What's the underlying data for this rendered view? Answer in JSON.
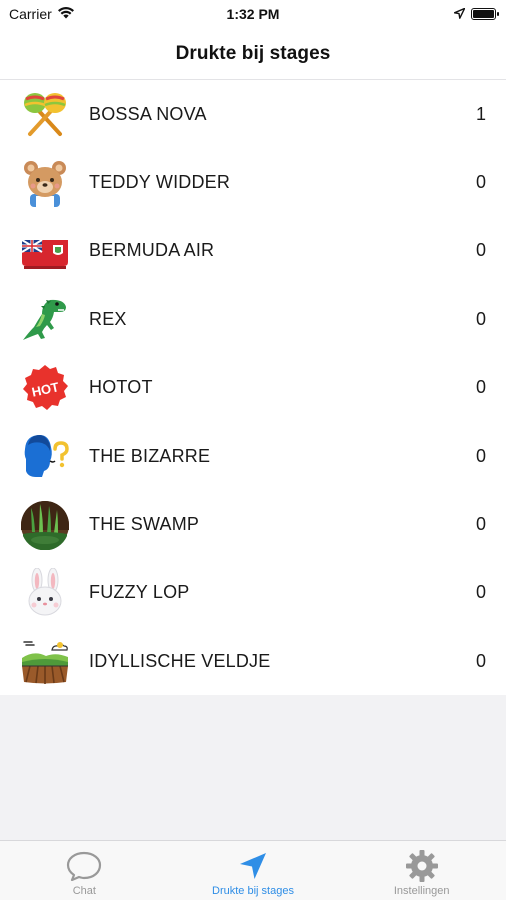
{
  "status_bar": {
    "carrier": "Carrier",
    "time": "1:32 PM"
  },
  "nav": {
    "title": "Drukte bij stages"
  },
  "stages": [
    {
      "name": "BOSSA NOVA",
      "count": "1",
      "icon": "maracas-icon"
    },
    {
      "name": "TEDDY WIDDER",
      "count": "0",
      "icon": "teddy-bear-icon"
    },
    {
      "name": "BERMUDA AIR",
      "count": "0",
      "icon": "bermuda-flag-plane-icon"
    },
    {
      "name": "REX",
      "count": "0",
      "icon": "dinosaur-icon"
    },
    {
      "name": "HOTOT",
      "count": "0",
      "icon": "hot-badge-icon"
    },
    {
      "name": "THE BIZARRE",
      "count": "0",
      "icon": "question-head-icon"
    },
    {
      "name": "THE SWAMP",
      "count": "0",
      "icon": "swamp-icon"
    },
    {
      "name": "FUZZY LOP",
      "count": "0",
      "icon": "rabbit-icon"
    },
    {
      "name": "IDYLLISCHE VELDJE",
      "count": "0",
      "icon": "field-landscape-icon"
    }
  ],
  "tabs": [
    {
      "label": "Chat",
      "icon": "chat-bubble-icon",
      "active": false
    },
    {
      "label": "Drukte bij stages",
      "icon": "location-arrow-icon",
      "active": true
    },
    {
      "label": "Instellingen",
      "icon": "gear-icon",
      "active": false
    }
  ],
  "colors": {
    "accent": "#2f8ee6",
    "inactive_tab": "#999999",
    "background": "#f2f2f4"
  }
}
